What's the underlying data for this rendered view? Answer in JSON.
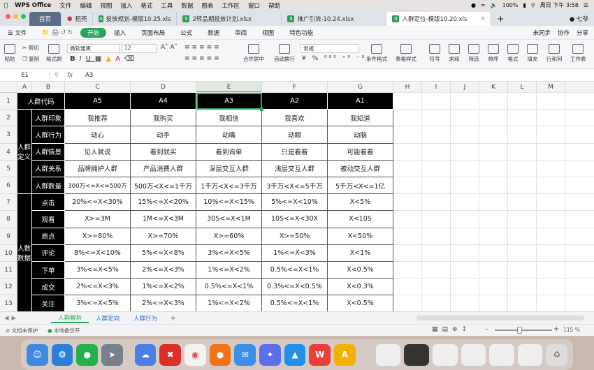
{
  "menubar": {
    "apple": "",
    "app": "WPS Office",
    "items": [
      "文件",
      "编辑",
      "视图",
      "插入",
      "格式",
      "工具",
      "数据",
      "图表",
      "工作区",
      "窗口",
      "帮助"
    ],
    "battery": "100%",
    "clock": "周日 下午 3:58"
  },
  "tabs": [
    {
      "label": "首页"
    },
    {
      "label": "稻壳"
    },
    {
      "label": "投放规划-模版10.25.xls"
    },
    {
      "label": "2转品期投放计划.xlsx"
    },
    {
      "label": "推广引流-10.24.xlsx"
    },
    {
      "label": "人群定位-模版10.20.xls"
    }
  ],
  "user": "七爷",
  "ribbon": {
    "file": "文件",
    "tabs": [
      "开始",
      "插入",
      "页面布局",
      "公式",
      "数据",
      "审阅",
      "视图",
      "特色功能"
    ],
    "right": [
      "未同步",
      "协作",
      "分享"
    ]
  },
  "toolbar": {
    "paste": "粘贴",
    "cut": "剪切",
    "copy": "复制",
    "format_painter": "格式刷",
    "font": "微软雅黑",
    "size": "12",
    "merge": "合并居中",
    "wrap": "自动换行",
    "numfmt": "常规",
    "cond": "条件格式",
    "table": "表格样式",
    "symbol": "符号",
    "sum": "求和",
    "filter": "筛选",
    "sort": "排序",
    "format": "格式",
    "fill": "填充",
    "rowcol": "行和列",
    "sheet": "工作表"
  },
  "formula": {
    "cell": "E1",
    "fx": "fx",
    "value": "A3"
  },
  "cols": [
    "A",
    "B",
    "C",
    "D",
    "E",
    "F",
    "G",
    "H",
    "I",
    "J",
    "K",
    "L",
    "M"
  ],
  "rows": [
    "1",
    "2",
    "3",
    "4",
    "5",
    "6",
    "7",
    "8",
    "9",
    "10",
    "11",
    "12",
    "13"
  ],
  "sheet": {
    "header": {
      "label": "人群代码",
      "levels": [
        "A5",
        "A4",
        "A3",
        "A2",
        "A1"
      ]
    },
    "group1": "人群定义",
    "group2": "人数数据",
    "rows": [
      {
        "label": "人群印象",
        "vals": [
          "我推荐",
          "我购买",
          "我相信",
          "我喜欢",
          "我知道"
        ]
      },
      {
        "label": "人群行为",
        "vals": [
          "动心",
          "动手",
          "动嘴",
          "动眼",
          "动脑"
        ]
      },
      {
        "label": "人群情景",
        "vals": [
          "见人就说",
          "看到就买",
          "看到询单",
          "只是看看",
          "可能看看"
        ]
      },
      {
        "label": "人群关系",
        "vals": [
          "品牌拥护人群",
          "产品消费人群",
          "深层交互人群",
          "浅层交互人群",
          "被动交互人群"
        ]
      },
      {
        "label": "人群数量",
        "vals": [
          "300万<=X<=500万",
          "500万<X<=1千万",
          "1千万<X<=3千万",
          "3千万<X<=5千万",
          "5千万<X<=1亿"
        ]
      },
      {
        "label": "点击",
        "vals": [
          "20%<=X<30%",
          "15%<=X<20%",
          "10%<=X<15%",
          "5%<=X<10%",
          "X<5%"
        ]
      },
      {
        "label": "观看",
        "vals": [
          "X>=3M",
          "1M<=X<3M",
          "30S<=X<1M",
          "10S<=X<30X",
          "X<10S"
        ]
      },
      {
        "label": "商点",
        "vals": [
          "X>=80%",
          "X>=70%",
          "X>=60%",
          "X>=50%",
          "X<50%"
        ]
      },
      {
        "label": "评论",
        "vals": [
          "8%<=X<10%",
          "5%<=X<8%",
          "3%<=X<5%",
          "1%<=X<3%",
          "X<1%"
        ]
      },
      {
        "label": "下单",
        "vals": [
          "3%<=X<5%",
          "2%<=X<3%",
          "1%<=X<2%",
          "0.5%<=X<1%",
          "X<0.5%"
        ]
      },
      {
        "label": "成交",
        "vals": [
          "2%<=X<3%",
          "1%<=X<2%",
          "0.5%<=X<1%",
          "0.3%<=X<0.5%",
          "X<0.3%"
        ]
      },
      {
        "label": "关注",
        "vals": [
          "3%<=X<5%",
          "2%<=X<3%",
          "1%<=X<2%",
          "0.5%<=X<1%",
          "X<0.5%"
        ]
      }
    ]
  },
  "sheettabs": [
    "人群解析",
    "人群定向",
    "人群行为"
  ],
  "status": {
    "left1": "文档未保护",
    "left2": "本地备份开",
    "zoom": "115 %"
  },
  "dock": [
    "Finder",
    "Safari",
    "WeChat",
    "Launchpad",
    "Baidu",
    "XMind",
    "Chrome",
    "Firefox",
    "Mail",
    "Feishu",
    "DingTalk",
    "WPS",
    "Sketch"
  ],
  "colors": {
    "green": "#26a65b",
    "black": "#000000"
  }
}
